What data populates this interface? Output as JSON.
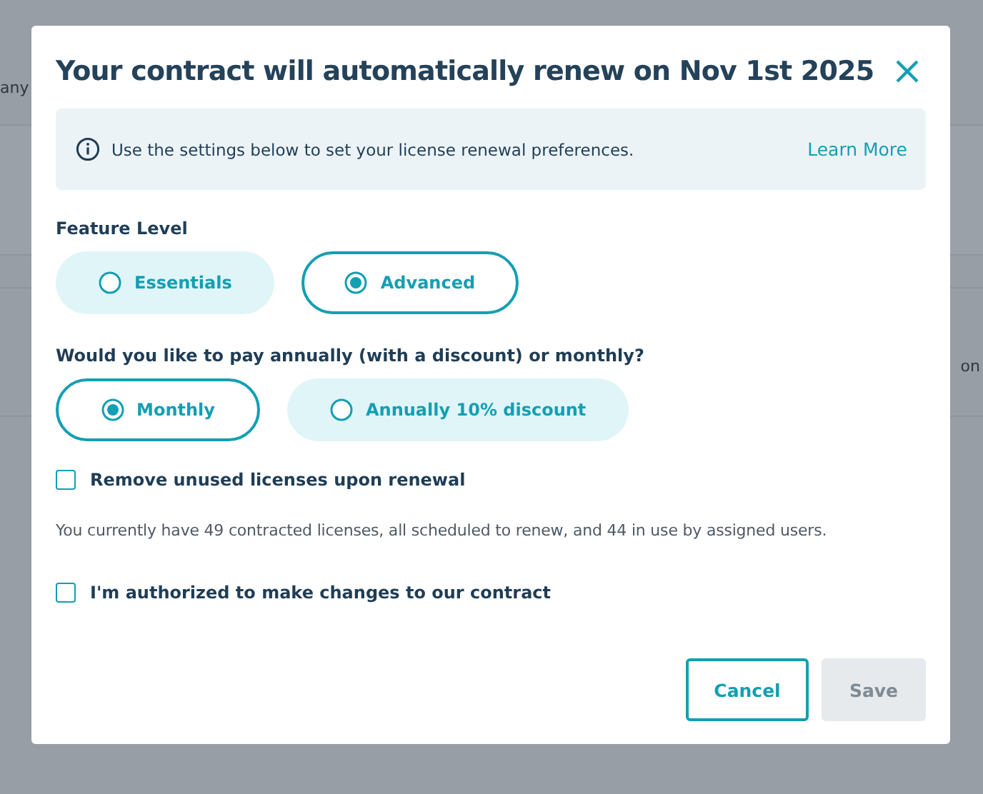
{
  "background": {
    "texts": [
      "any",
      "on"
    ]
  },
  "dialog": {
    "title": "Your contract will automatically renew on Nov 1st 2025",
    "info": {
      "text": "Use the settings below to set your license renewal preferences.",
      "link": "Learn More"
    },
    "groups": [
      {
        "label": "Feature Level",
        "options": [
          {
            "label": "Essentials",
            "selected": false
          },
          {
            "label": "Advanced",
            "selected": true
          }
        ]
      },
      {
        "label": "Would you like to pay annually (with a discount) or monthly?",
        "options": [
          {
            "label": "Monthly",
            "selected": true
          },
          {
            "label": "Annually 10% discount",
            "selected": false
          }
        ]
      }
    ],
    "items": [
      {
        "kind": "checkbox",
        "label": "Remove unused licenses upon renewal",
        "checked": false
      },
      {
        "kind": "note",
        "text": "You currently have 49 contracted licenses, all scheduled to renew, and 44 in use by assigned users."
      },
      {
        "kind": "checkbox",
        "label": "I'm authorized to make changes to our contract",
        "checked": false
      }
    ],
    "buttons": [
      {
        "label": "Cancel",
        "kind": "secondary",
        "disabled": false
      },
      {
        "label": "Save",
        "kind": "primary",
        "disabled": true
      }
    ]
  }
}
